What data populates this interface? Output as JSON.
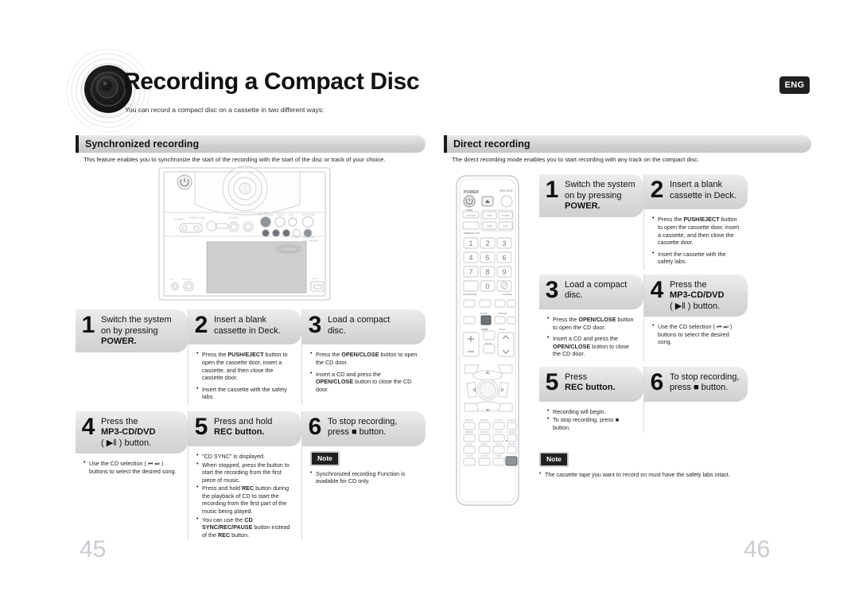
{
  "header": {
    "title": "Recording a Compact Disc",
    "subtitle": "You can record a compact disc on a cassette in two different ways:",
    "language_badge": "ENG",
    "icon": "speaker-graphic"
  },
  "page_numbers": {
    "left": "45",
    "right": "46"
  },
  "left_section": {
    "heading": "Synchronized recording",
    "description": "This feature enables you to synchronize the start of the recording with the start of the disc or track of your choice.",
    "device_image": "mini-hifi-system-front-panel",
    "steps": [
      {
        "number": "1",
        "line1": "Switch the system",
        "line2": "on by pressing",
        "line3": "POWER.",
        "bullets": []
      },
      {
        "number": "2",
        "line1": "Insert a blank",
        "line2": "cassette in Deck.",
        "line3": "",
        "bullets": [
          "Press the PUSH/EJECT button to open the cassette door, insert a cassette, and then close the cassette door.",
          "Insert the cassette with the safety labs."
        ]
      },
      {
        "number": "3",
        "line1": "Load a compact",
        "line2": "disc.",
        "line3": "",
        "bullets": [
          "Press the OPEN/CLOSE button to open the CD door.",
          "Insert a CD and press the OPEN/CLOSE button to close the CD door."
        ]
      },
      {
        "number": "4",
        "line1": "Press the",
        "line2": "MP3-CD/DVD",
        "line3": "( ▶‖ ) button.",
        "bullets": [
          "Use the CD selection ( ⏮ ⏭ ) buttons to select the desired song."
        ]
      },
      {
        "number": "5",
        "line1": "Press and hold",
        "line2": "REC button.",
        "line3": "",
        "bullets": [
          "\"CD SYNC\" is displayed.",
          "When stopped, press the button to start the recording from the first piece of music.",
          "Press and hold REC button during the playback of CD to start the recording from the first part of the music being played.",
          "You can use the CD SYNC/REC/PAUSE button instead of the REC button."
        ]
      },
      {
        "number": "6",
        "line1": "To stop recording,",
        "line2": "press ■ button.",
        "line3": "",
        "bullets": [],
        "note_label": "Note",
        "notes": [
          "Synchronized recording Function is available for  CD only."
        ]
      }
    ]
  },
  "right_section": {
    "heading": "Direct recording",
    "description": "The direct recording mode enables you to start recording with any track on the compact disc.",
    "device_image": "remote-control",
    "remote": {
      "power_label": "POWER",
      "disc_skip_label": "DISC SKIP",
      "timer_label": "TIMER",
      "on_off_label": "ON/OFF",
      "timer_clock_label": "TIMER/CLOCK",
      "source_buttons": [
        "DVD",
        "TUNER",
        "TAPE",
        "AUX"
      ],
      "keypad": [
        "1",
        "2",
        "3",
        "4",
        "5",
        "6",
        "7",
        "8",
        "9",
        "0"
      ],
      "cd_ripping_label": "CD RIPPING",
      "cancel_label": "CANCEL",
      "stop_label": "STOP",
      "play_label": "PLAY",
      "pause_label": "PAUSE",
      "vol_label": "VOL",
      "mute_label": "MUTE",
      "audio_label": "AUDIO",
      "tuning_label": "TUNING",
      "enter_label": "ENTER",
      "rec_label": "REC",
      "bottom_rows": [
        [
          "REPEAT",
          "REPEAT A-B",
          "P.SCAN MODE",
          "SHUFFLE"
        ],
        [
          "DIMMER",
          "P.SOUND",
          "P.BASS",
          "P.EFFECT"
        ],
        [
          "SLEEP",
          "NIGHT",
          "ANGLE",
          "REMAIN"
        ],
        [
          "SLOW",
          "ZOOM",
          "VIDEO SEL.",
          "REC"
        ]
      ]
    },
    "steps": [
      {
        "number": "1",
        "line1": "Switch the system",
        "line2": "on by pressing",
        "line3": "POWER.",
        "bullets": []
      },
      {
        "number": "2",
        "line1": "Insert a blank",
        "line2": "cassette in Deck.",
        "line3": "",
        "bullets": [
          "Press the PUSH/EJECT button to open the cassette door, insert a cassette, and then close the cassette door.",
          "Insert the cassette with the safety labs."
        ]
      },
      {
        "number": "3",
        "line1": "Load a compact",
        "line2": "disc.",
        "line3": "",
        "bullets": [
          "Press the OPEN/CLOSE button to open the CD door.",
          "Insert a CD and press the OPEN/CLOSE button to close the CD door."
        ]
      },
      {
        "number": "4",
        "line1": "Press the",
        "line2": "MP3-CD/DVD",
        "line3": "( ▶‖ ) button.",
        "bullets": [
          "Use the CD selection ( ⏮ ⏭ ) buttons to select the desired song."
        ]
      },
      {
        "number": "5",
        "line1": "Press",
        "line2": "REC button.",
        "line3": "",
        "bullets": [
          "Recording will begin.",
          "To stop recording, press ■ button."
        ]
      },
      {
        "number": "6",
        "line1": "To stop recording,",
        "line2": "press ■ button.",
        "line3": "",
        "bullets": []
      }
    ],
    "note_label": "Note",
    "notes": [
      "The cassette tape you want to record on must have the safety labs intact."
    ]
  }
}
